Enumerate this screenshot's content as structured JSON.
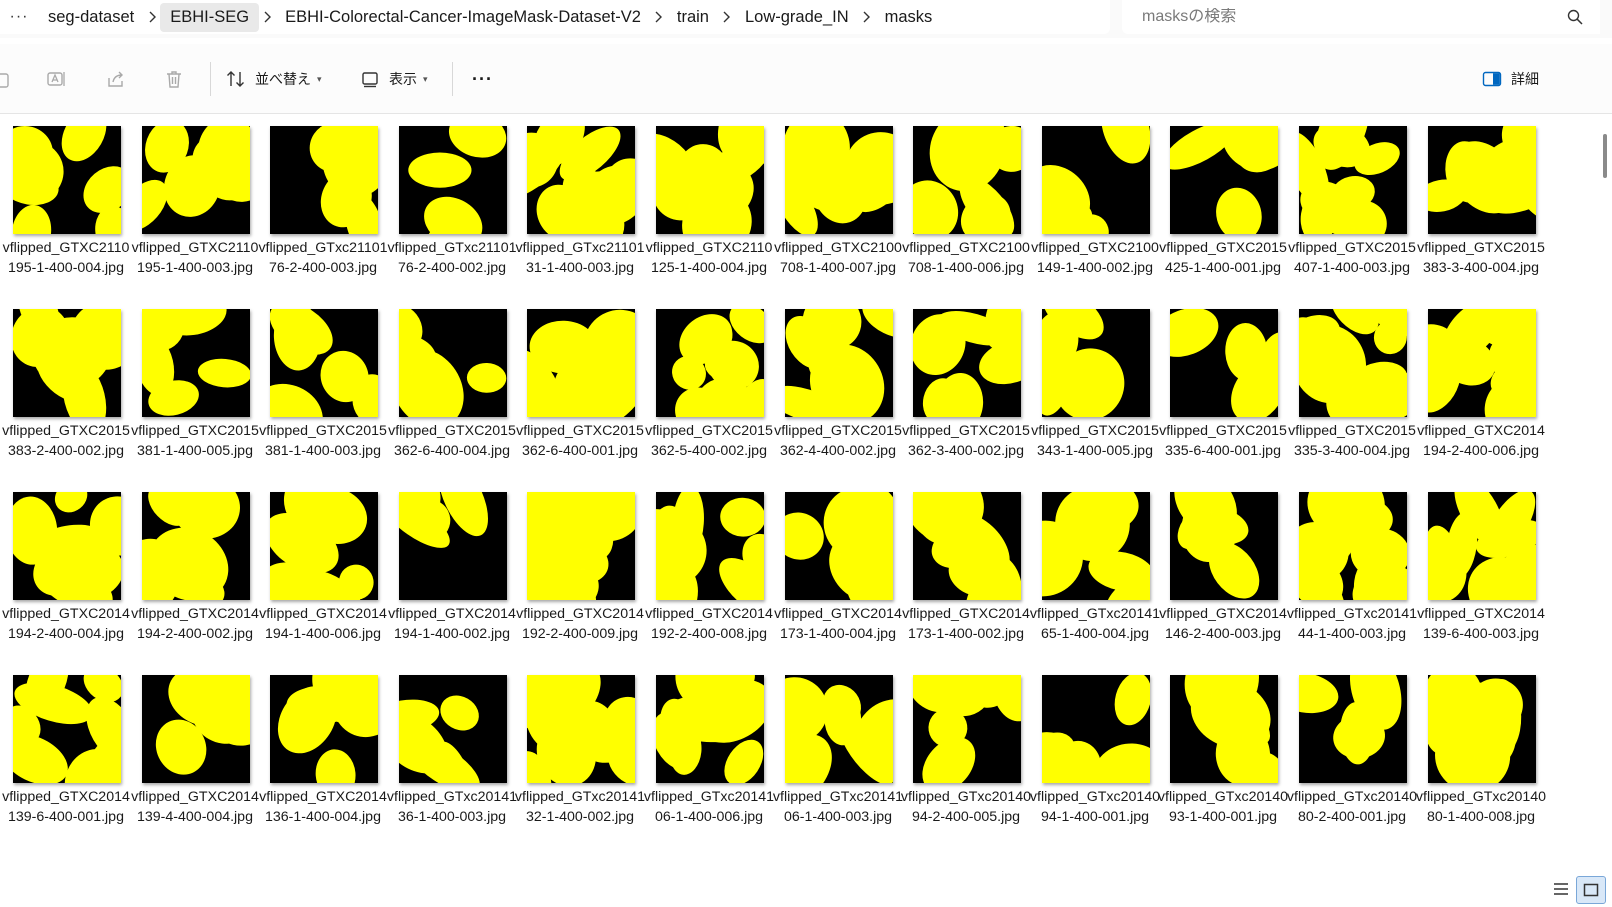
{
  "window": {
    "breadcrumb": [
      "seg-dataset",
      "EBHI-SEG",
      "EBHI-Colorectal-Cancer-ImageMask-Dataset-V2",
      "train",
      "Low-grade_IN",
      "masks"
    ],
    "more_label": "···",
    "search_placeholder": "masksの検索"
  },
  "toolbar": {
    "sort_label": "並べ替え",
    "view_label": "表示",
    "more_label": "···",
    "details_label": "詳細"
  },
  "colors": {
    "mask_fg": "#ffff00",
    "mask_bg": "#000000",
    "accent": "#0067c0"
  },
  "files": [
    {
      "name": "vflipped_GTXC2110195-1-400-004.jpg"
    },
    {
      "name": "vflipped_GTXC2110195-1-400-003.jpg"
    },
    {
      "name": "vflipped_GTxc2110176-2-400-003.jpg"
    },
    {
      "name": "vflipped_GTxc2110176-2-400-002.jpg"
    },
    {
      "name": "vflipped_GTxc2110131-1-400-003.jpg"
    },
    {
      "name": "vflipped_GTXC2110125-1-400-004.jpg"
    },
    {
      "name": "vflipped_GTXC2100708-1-400-007.jpg"
    },
    {
      "name": "vflipped_GTXC2100708-1-400-006.jpg"
    },
    {
      "name": "vflipped_GTXC2100149-1-400-002.jpg"
    },
    {
      "name": "vflipped_GTXC2015425-1-400-001.jpg"
    },
    {
      "name": "vflipped_GTXC2015407-1-400-003.jpg"
    },
    {
      "name": "vflipped_GTXC2015383-3-400-004.jpg"
    },
    {
      "name": "vflipped_GTXC2015383-2-400-002.jpg"
    },
    {
      "name": "vflipped_GTXC2015381-1-400-005.jpg"
    },
    {
      "name": "vflipped_GTXC2015381-1-400-003.jpg"
    },
    {
      "name": "vflipped_GTXC2015362-6-400-004.jpg"
    },
    {
      "name": "vflipped_GTXC2015362-6-400-001.jpg"
    },
    {
      "name": "vflipped_GTXC2015362-5-400-002.jpg"
    },
    {
      "name": "vflipped_GTXC2015362-4-400-002.jpg"
    },
    {
      "name": "vflipped_GTXC2015362-3-400-002.jpg"
    },
    {
      "name": "vflipped_GTXC2015343-1-400-005.jpg"
    },
    {
      "name": "vflipped_GTXC2015335-6-400-001.jpg"
    },
    {
      "name": "vflipped_GTXC2015335-3-400-004.jpg"
    },
    {
      "name": "vflipped_GTXC2014194-2-400-006.jpg"
    },
    {
      "name": "vflipped_GTXC2014194-2-400-004.jpg"
    },
    {
      "name": "vflipped_GTXC2014194-2-400-002.jpg"
    },
    {
      "name": "vflipped_GTXC2014194-1-400-006.jpg"
    },
    {
      "name": "vflipped_GTXC2014194-1-400-002.jpg"
    },
    {
      "name": "vflipped_GTXC2014192-2-400-009.jpg"
    },
    {
      "name": "vflipped_GTXC2014192-2-400-008.jpg"
    },
    {
      "name": "vflipped_GTXC2014173-1-400-004.jpg"
    },
    {
      "name": "vflipped_GTXC2014173-1-400-002.jpg"
    },
    {
      "name": "vflipped_GTxc2014165-1-400-004.jpg"
    },
    {
      "name": "vflipped_GTXC2014146-2-400-003.jpg"
    },
    {
      "name": "vflipped_GTxc2014144-1-400-003.jpg"
    },
    {
      "name": "vflipped_GTXC2014139-6-400-003.jpg"
    },
    {
      "name": "vflipped_GTXC2014139-6-400-001.jpg"
    },
    {
      "name": "vflipped_GTXC2014139-4-400-004.jpg"
    },
    {
      "name": "vflipped_GTXC2014136-1-400-004.jpg"
    },
    {
      "name": "vflipped_GTxc2014136-1-400-003.jpg"
    },
    {
      "name": "vflipped_GTxc2014132-1-400-002.jpg"
    },
    {
      "name": "vflipped_GTxc2014106-1-400-006.jpg"
    },
    {
      "name": "vflipped_GTxc2014106-1-400-003.jpg"
    },
    {
      "name": "vflipped_GTxc2014094-2-400-005.jpg"
    },
    {
      "name": "vflipped_GTxc2014094-1-400-001.jpg"
    },
    {
      "name": "vflipped_GTxc2014093-1-400-001.jpg"
    },
    {
      "name": "vflipped_GTxc2014080-2-400-001.jpg"
    },
    {
      "name": "vflipped_GTxc2014080-1-400-008.jpg"
    }
  ]
}
